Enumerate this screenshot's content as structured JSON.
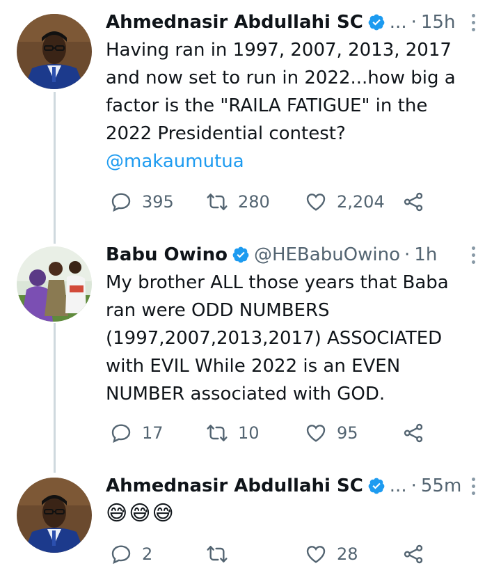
{
  "tweets": [
    {
      "author": "Ahmednasir Abdullahi SC",
      "handle": "...",
      "separator": "·",
      "time": "15h",
      "text_lines": [
        "Having ran in 1997, 2007, 2013, 2017",
        "and now set to run in 2022...how big a",
        "factor is the \"RAILA FATIGUE\" in the",
        "2022 Presidential contest?"
      ],
      "mention": "@makaumutua",
      "replies": "395",
      "retweets": "280",
      "likes": "2,204"
    },
    {
      "author": "Babu Owino",
      "handle": "@HEBabuOwino",
      "separator": "·",
      "time": "1h",
      "text_lines": [
        "My brother ALL those years that Baba",
        "ran were ODD NUMBERS",
        "(1997,2007,2013,2017) ASSOCIATED",
        "with EVIL While 2022 is an EVEN",
        "NUMBER associated with GOD."
      ],
      "replies": "17",
      "retweets": "10",
      "likes": "95"
    },
    {
      "author": "Ahmednasir Abdullahi SC",
      "handle": "...",
      "separator": "·",
      "time": "55m",
      "emoji": "😅😅😅",
      "replies": "2",
      "retweets": "",
      "likes": "28"
    }
  ],
  "colors": {
    "accent": "#1d9bf0",
    "secondary_text": "#536471",
    "thread_line": "#cfd9de"
  },
  "icons": [
    "verified-badge-icon",
    "more-dots-icon",
    "reply-icon",
    "retweet-icon",
    "like-icon",
    "share-icon"
  ]
}
